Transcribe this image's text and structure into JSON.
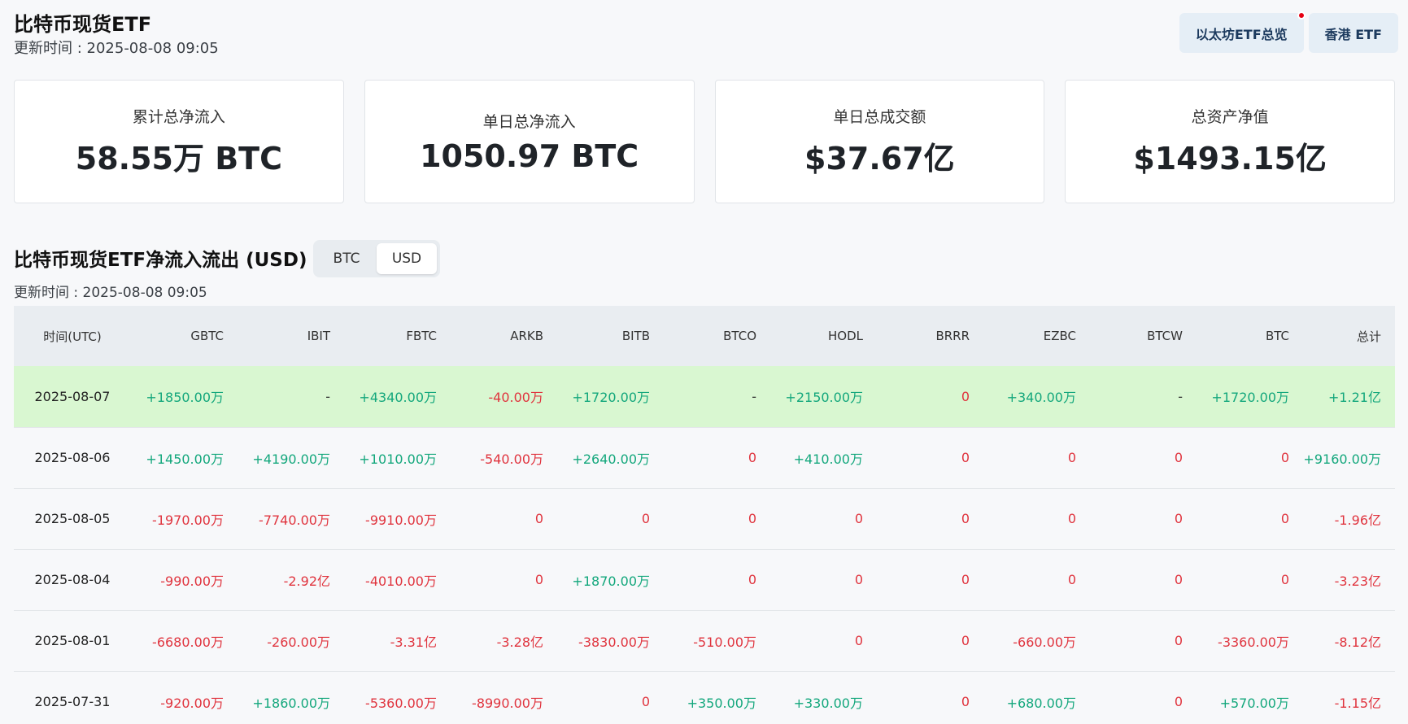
{
  "page": {
    "title": "比特币现货ETF",
    "update_time": "更新时间 : 2025-08-08 09:05"
  },
  "top_buttons": [
    {
      "label": "以太坊ETF总览",
      "has_notification": true
    },
    {
      "label": "香港 ETF",
      "has_notification": false
    }
  ],
  "stats": [
    {
      "label": "累计总净流入",
      "value": "58.55万 BTC"
    },
    {
      "label": "单日总净流入",
      "value": "1050.97 BTC"
    },
    {
      "label": "单日总成交额",
      "value": "$37.67亿"
    },
    {
      "label": "总资产净值",
      "value": "$1493.15亿"
    }
  ],
  "flows": {
    "title": "比特币现货ETF净流入流出 (USD)",
    "update_time": "更新时间 : 2025-08-08 09:05",
    "toggle": {
      "options": [
        "BTC",
        "USD"
      ],
      "selected": "USD"
    },
    "columns": [
      "时间(UTC)",
      "GBTC",
      "IBIT",
      "FBTC",
      "ARKB",
      "BITB",
      "BTCO",
      "HODL",
      "BRRR",
      "EZBC",
      "BTCW",
      "BTC",
      "总计"
    ],
    "rows": [
      {
        "date": "2025-08-07",
        "highlighted": true,
        "cells": [
          "+1850.00万",
          "-",
          "+4340.00万",
          "-40.00万",
          "+1720.00万",
          "-",
          "+2150.00万",
          "0",
          "+340.00万",
          "-",
          "+1720.00万",
          "+1.21亿"
        ]
      },
      {
        "date": "2025-08-06",
        "highlighted": false,
        "cells": [
          "+1450.00万",
          "+4190.00万",
          "+1010.00万",
          "-540.00万",
          "+2640.00万",
          "0",
          "+410.00万",
          "0",
          "0",
          "0",
          "0",
          "+9160.00万"
        ]
      },
      {
        "date": "2025-08-05",
        "highlighted": false,
        "cells": [
          "-1970.00万",
          "-7740.00万",
          "-9910.00万",
          "0",
          "0",
          "0",
          "0",
          "0",
          "0",
          "0",
          "0",
          "-1.96亿"
        ]
      },
      {
        "date": "2025-08-04",
        "highlighted": false,
        "cells": [
          "-990.00万",
          "-2.92亿",
          "-4010.00万",
          "0",
          "+1870.00万",
          "0",
          "0",
          "0",
          "0",
          "0",
          "0",
          "-3.23亿"
        ]
      },
      {
        "date": "2025-08-01",
        "highlighted": false,
        "cells": [
          "-6680.00万",
          "-260.00万",
          "-3.31亿",
          "-3.28亿",
          "-3830.00万",
          "-510.00万",
          "0",
          "0",
          "-660.00万",
          "0",
          "-3360.00万",
          "-8.12亿"
        ]
      },
      {
        "date": "2025-07-31",
        "highlighted": false,
        "cells": [
          "-920.00万",
          "+1860.00万",
          "-5360.00万",
          "-8990.00万",
          "0",
          "+350.00万",
          "+330.00万",
          "0",
          "+680.00万",
          "0",
          "+570.00万",
          "-1.15亿"
        ]
      }
    ]
  },
  "colors": {
    "positive": "#13a77c",
    "negative": "#e0343e",
    "neutral": "#333333",
    "highlight_row": "#d9f7d1"
  }
}
